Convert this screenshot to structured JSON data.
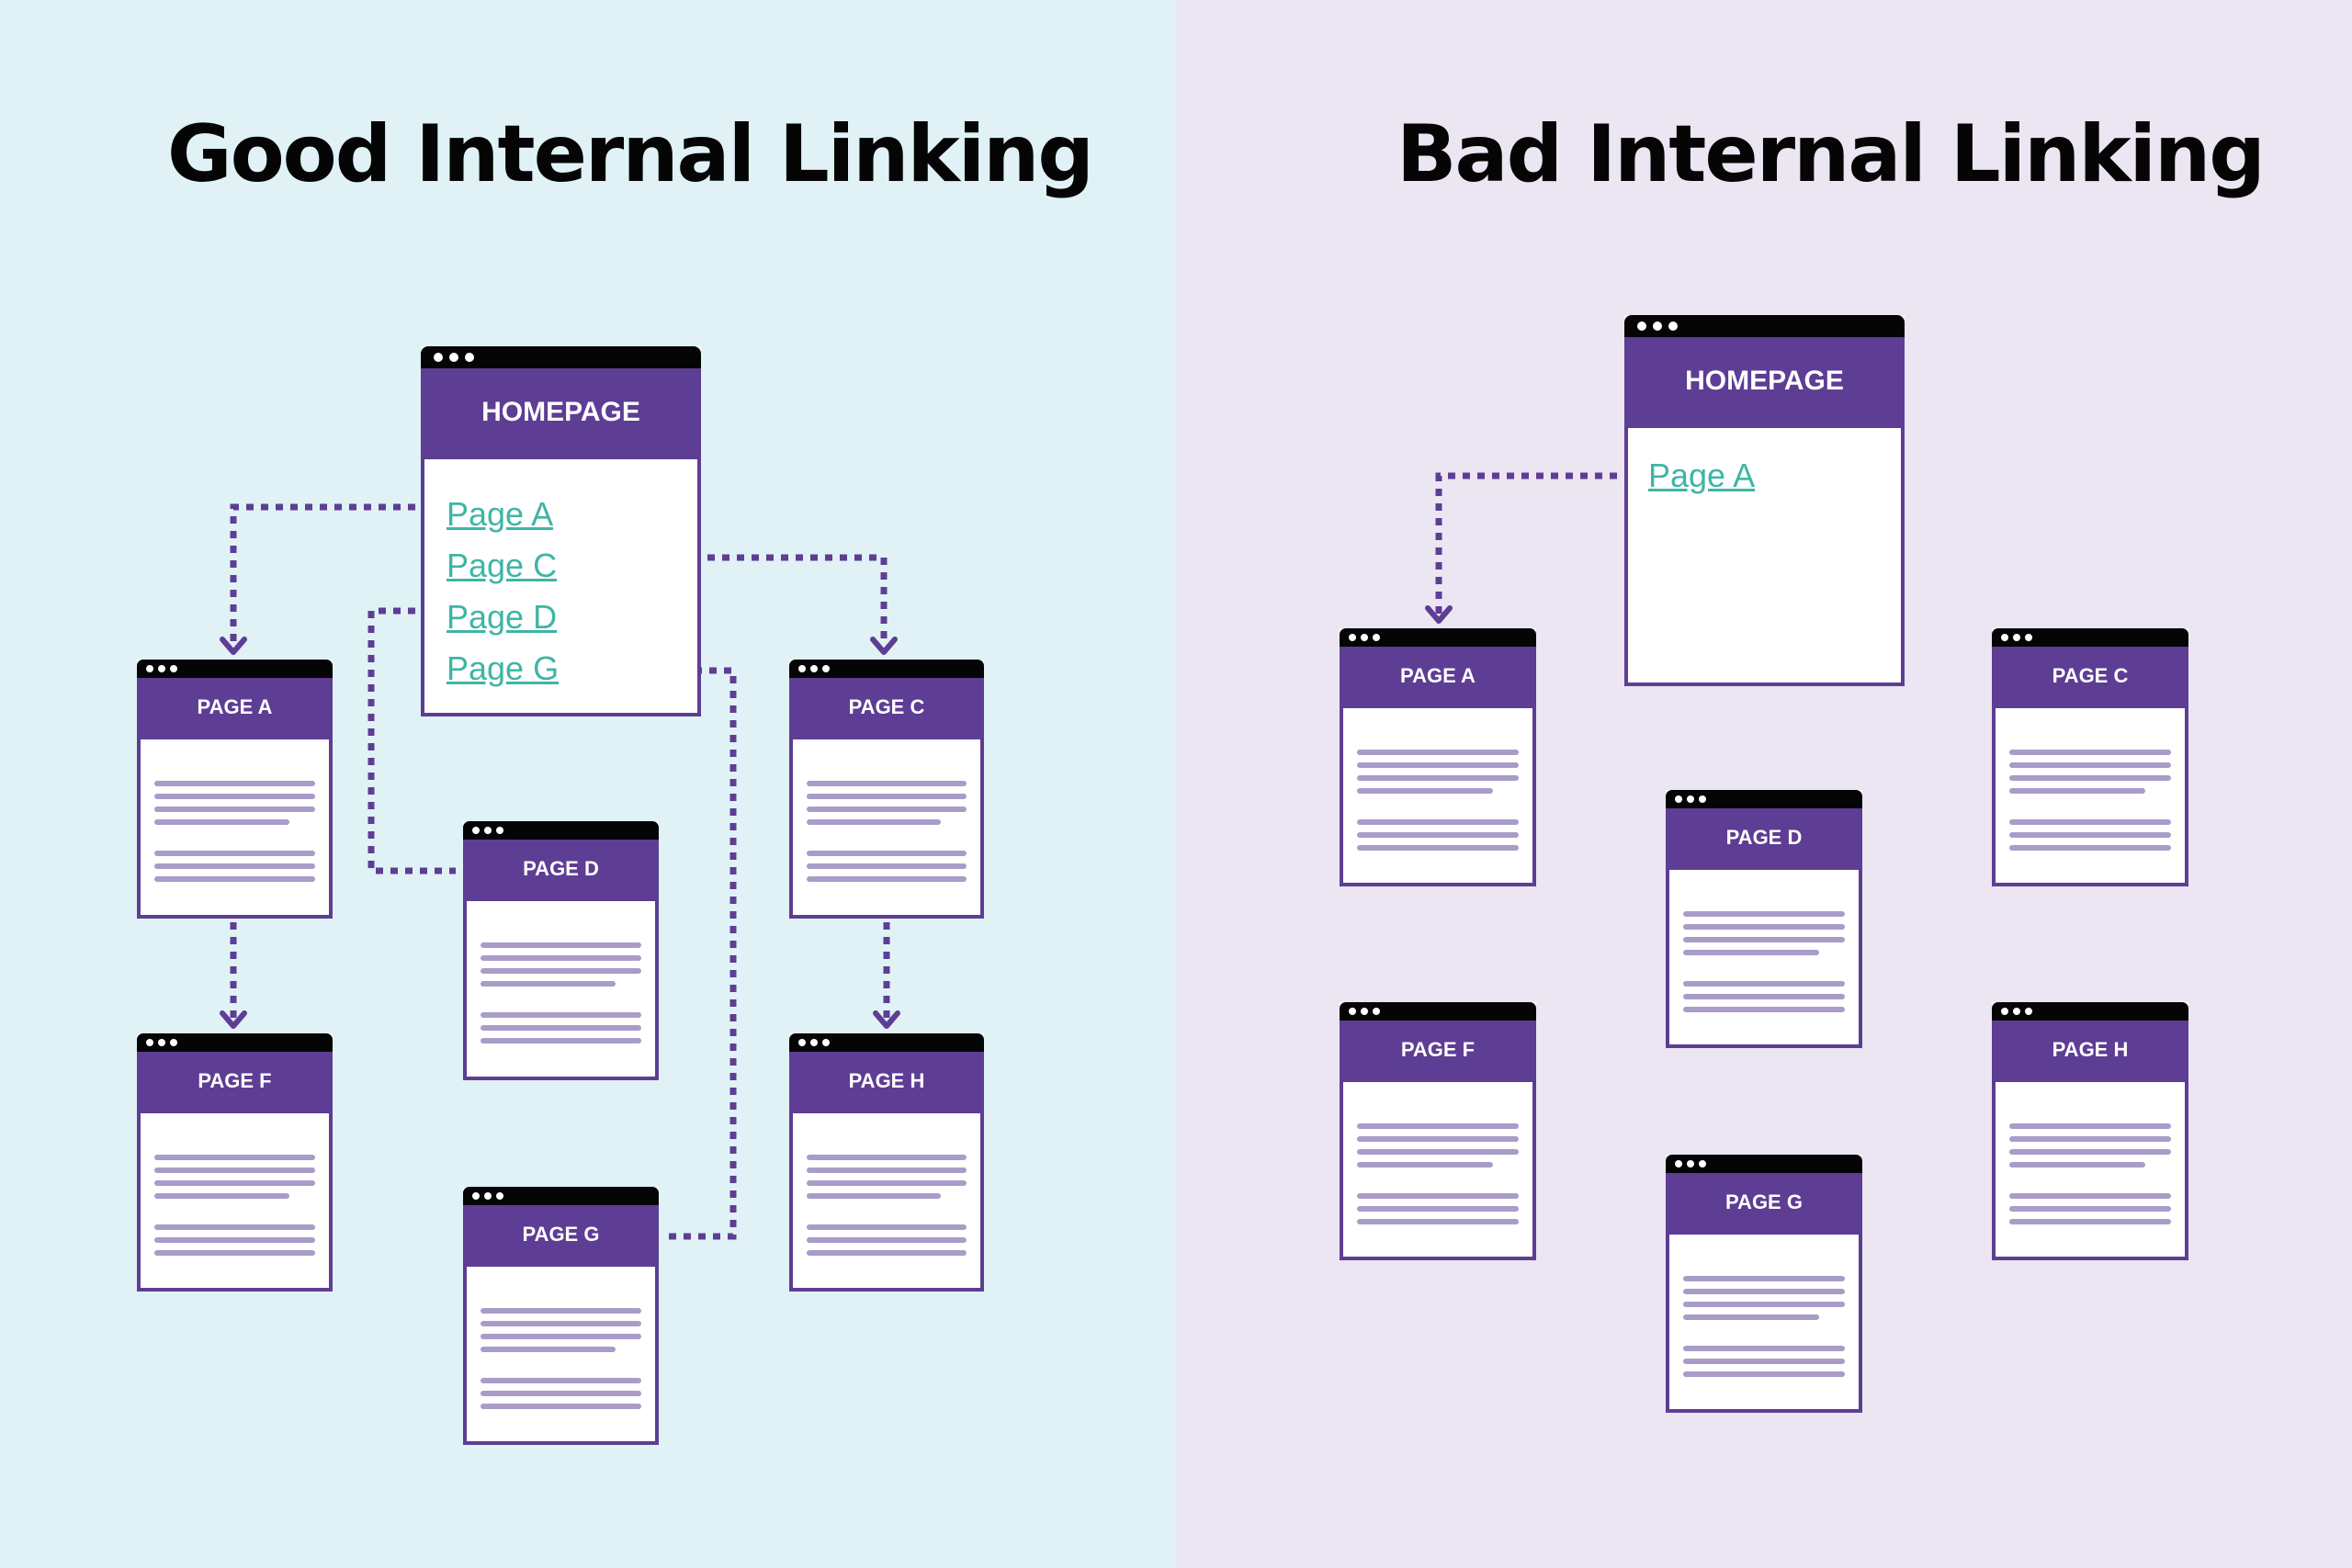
{
  "good": {
    "title": "Good Internal Linking",
    "homepage": {
      "label": "HOMEPAGE",
      "links": [
        "Page A",
        "Page C",
        "Page D",
        "Page G"
      ]
    },
    "pages": {
      "a": "PAGE A",
      "c": "PAGE C",
      "d": "PAGE D",
      "f": "PAGE F",
      "g": "PAGE G",
      "h": "PAGE H"
    },
    "connections": [
      {
        "from": "Homepage link Page A",
        "to": "PAGE A"
      },
      {
        "from": "Homepage link Page C",
        "to": "PAGE C"
      },
      {
        "from": "Homepage link Page D",
        "to": "PAGE D"
      },
      {
        "from": "Homepage link Page G",
        "to": "PAGE G"
      },
      {
        "from": "PAGE A",
        "to": "PAGE F"
      },
      {
        "from": "PAGE C",
        "to": "PAGE H"
      }
    ]
  },
  "bad": {
    "title": "Bad Internal Linking",
    "homepage": {
      "label": "HOMEPAGE",
      "links": [
        "Page A"
      ]
    },
    "pages": {
      "a": "PAGE A",
      "c": "PAGE C",
      "d": "PAGE D",
      "f": "PAGE F",
      "g": "PAGE G",
      "h": "PAGE H"
    },
    "connections": [
      {
        "from": "Homepage link Page A",
        "to": "PAGE A"
      }
    ]
  },
  "colors": {
    "good_bg": "#e0f2f5",
    "bad_bg": "#ebe6f2",
    "purple": "#5e3d94",
    "link": "#3fb5a5",
    "text_line": "#a99cc8"
  }
}
